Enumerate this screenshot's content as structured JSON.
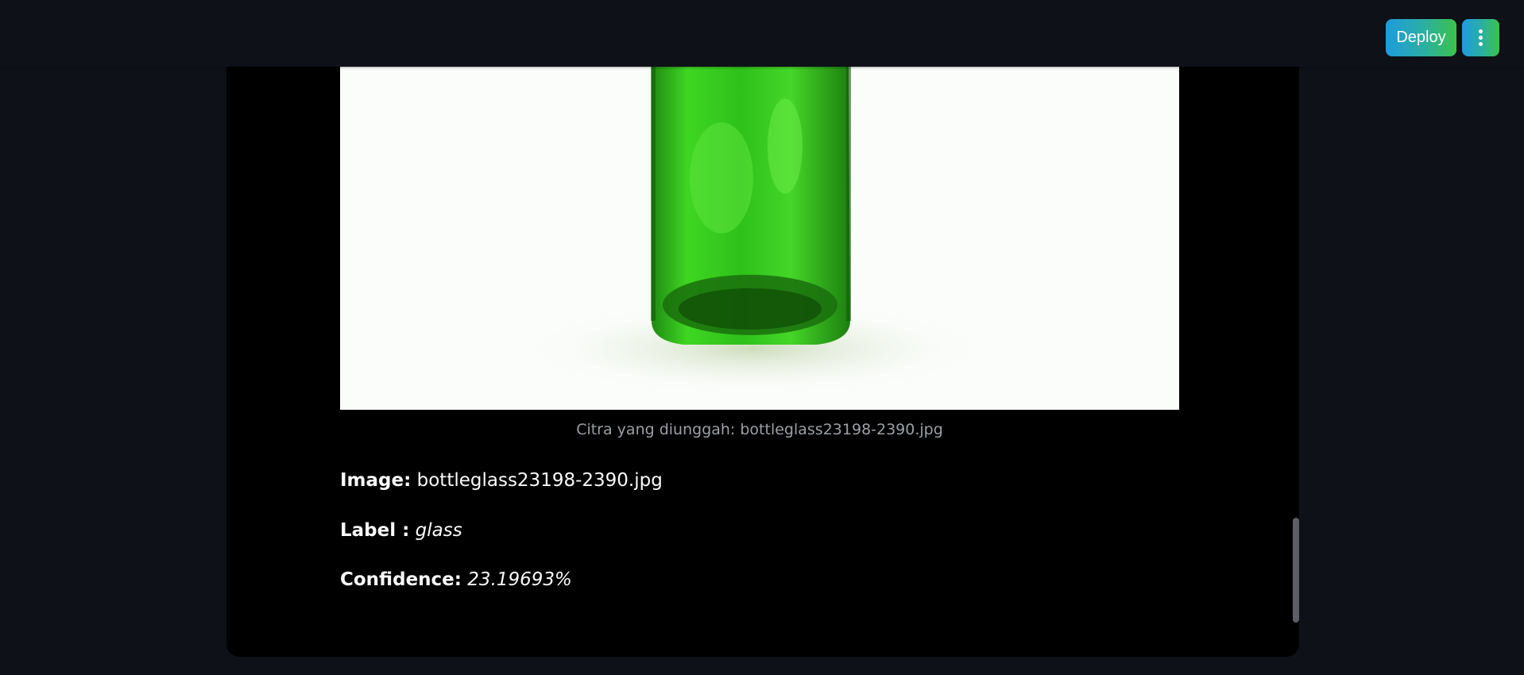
{
  "header": {
    "deploy_label": "Deploy",
    "menu_icon": "vertical-ellipsis-icon"
  },
  "result": {
    "image_alt": "green glass bottle",
    "caption": "Citra yang diunggah: bottleglass23198-2390.jpg",
    "image_label": "Image:",
    "image_value": "bottleglass23198-2390.jpg",
    "label_label": "Label :",
    "label_value": "glass",
    "confidence_label": "Confidence:",
    "confidence_value": "23.19693%"
  },
  "colors": {
    "page_bg": "#0e1117",
    "card_bg": "#000000",
    "accent_start": "#1e9be0",
    "accent_end": "#3cc24a",
    "bottle_green": "#3cc81c"
  }
}
